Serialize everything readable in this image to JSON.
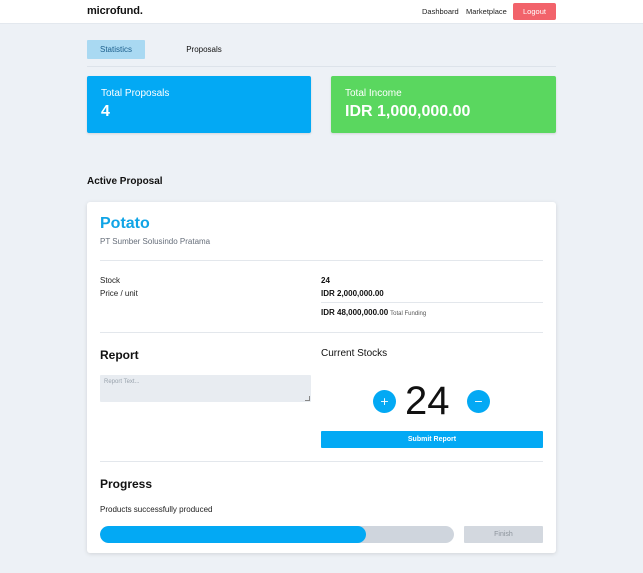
{
  "navbar": {
    "brand": "microfund",
    "brand_dot": ".",
    "links": [
      "Dashboard",
      "Marketplace"
    ],
    "logout_label": "Logout",
    "logout_color": "#f2636b"
  },
  "tabs": {
    "items": [
      "Statistics",
      "Proposals"
    ],
    "active": "Statistics"
  },
  "stats": {
    "total_proposals_label": "Total Proposals",
    "total_proposals_value": "4",
    "total_income_label": "Total Income",
    "total_income_value": "IDR 1,000,000.00",
    "proposals_color": "#03a9f4",
    "income_color": "#5ad75f"
  },
  "active_proposal": {
    "section_title": "Active Proposal",
    "product": "Potato",
    "company": "PT Sumber Solusindo Pratama",
    "stock_label": "Stock",
    "stock_value": "24",
    "price_label": "Price / unit",
    "price_value": "IDR 2,000,000.00",
    "total_value": "IDR 48,000,000.00",
    "total_label": "Total Funding"
  },
  "report": {
    "heading": "Report",
    "placeholder": "Report Text..."
  },
  "current_stocks": {
    "heading": "Current Stocks",
    "count": "24",
    "plus_icon": "+",
    "minus_icon": "−",
    "submit_label": "Submit Report"
  },
  "progress": {
    "heading": "Progress",
    "caption": "Products successfully produced",
    "fraction": 0.75,
    "finish_label": "Finish"
  }
}
